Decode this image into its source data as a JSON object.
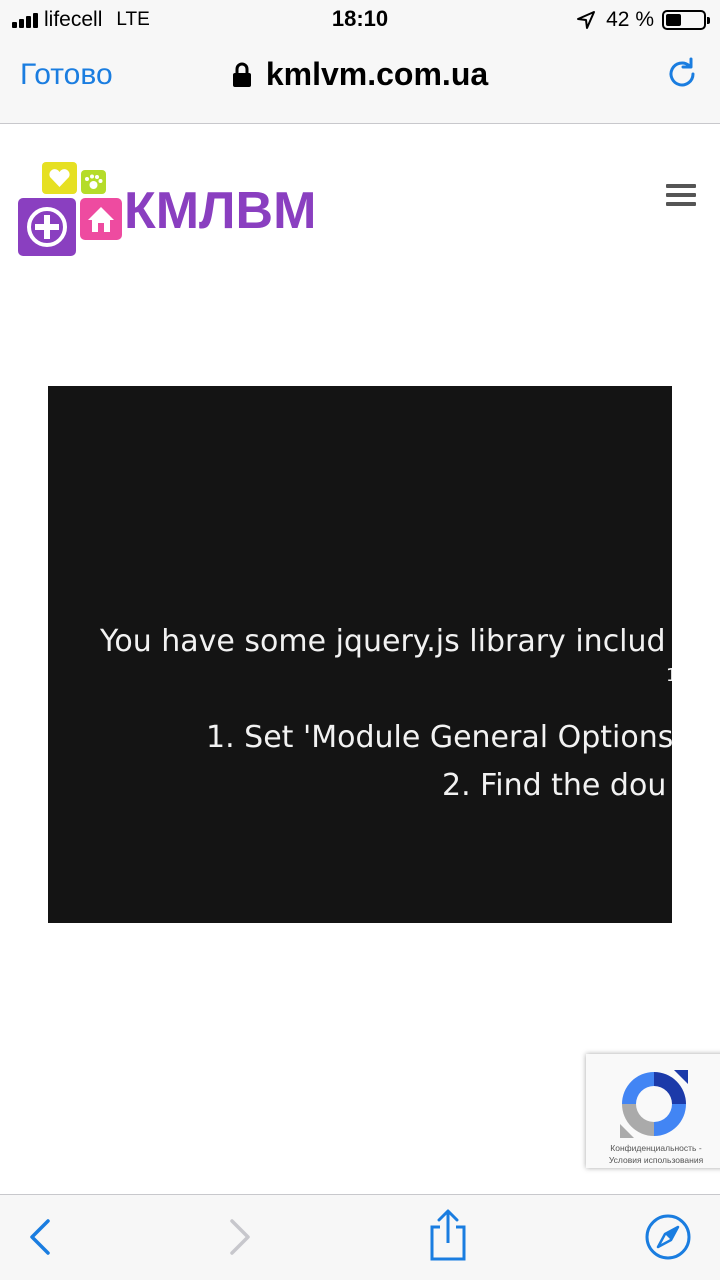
{
  "status_bar": {
    "carrier": "lifecell",
    "network": "LTE",
    "time": "18:10",
    "battery_percent": "42 %",
    "battery_level": 0.42
  },
  "browser": {
    "done_label": "Готово",
    "url": "kmlvm.com.ua"
  },
  "site": {
    "logo_text": "КМЛВМ"
  },
  "error": {
    "line1": "You have some jquery.js library includ",
    "line2": "1",
    "line3": "1. Set 'Module General Options",
    "line4": "2. Find the dou"
  },
  "recaptcha": {
    "privacy": "Конфиденциальность",
    "separator": "-",
    "terms": "Условия использования"
  },
  "colors": {
    "accent": "#1a7de0",
    "logo_purple": "#8a3fc0",
    "logo_yellow": "#e6e022",
    "logo_green": "#b5dc2a",
    "logo_pink": "#ee4ba0",
    "error_bg": "#141414"
  },
  "icons": {
    "lock": "lock-icon",
    "reload": "reload-icon",
    "menu": "hamburger-menu-icon",
    "back": "chevron-left-icon",
    "forward": "chevron-right-icon",
    "share": "share-icon",
    "compass": "compass-icon"
  }
}
